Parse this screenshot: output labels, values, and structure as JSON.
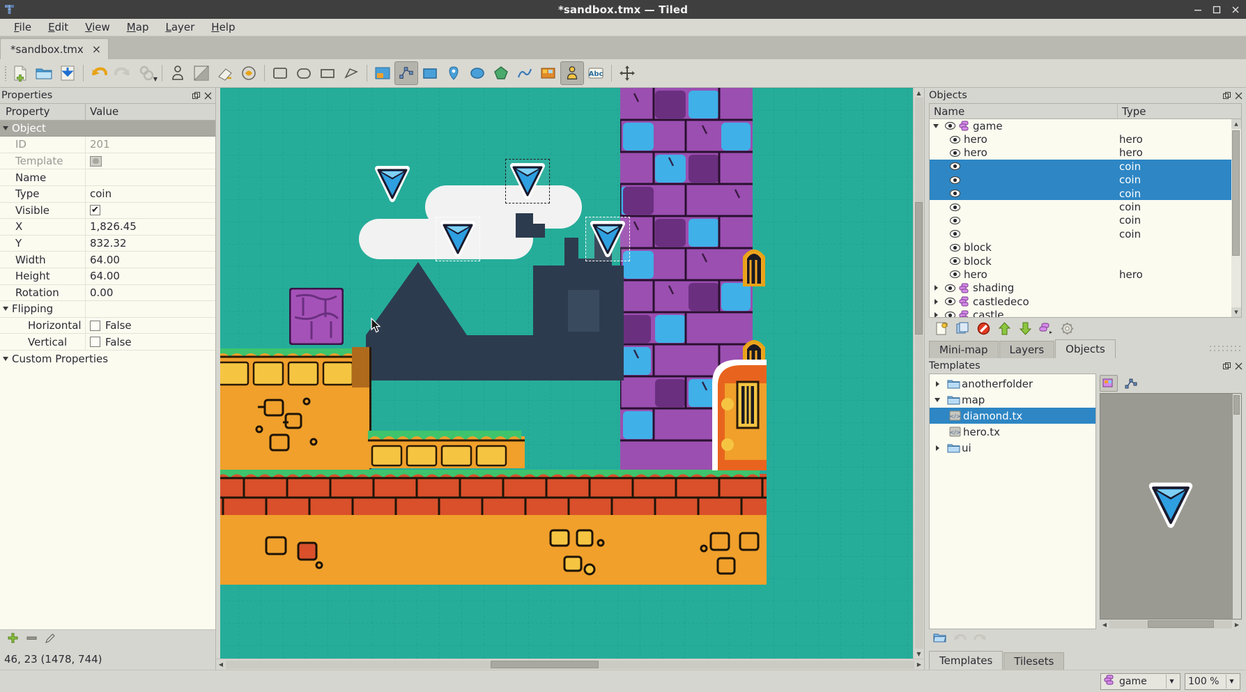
{
  "window": {
    "title": "*sandbox.tmx — Tiled",
    "icon": "tiled-logo-icon",
    "minimize": "minimize-icon",
    "maximize": "maximize-icon",
    "close": "close-icon"
  },
  "menubar": {
    "items": [
      {
        "label": "File",
        "accel": "F"
      },
      {
        "label": "Edit",
        "accel": "E"
      },
      {
        "label": "View",
        "accel": "V"
      },
      {
        "label": "Map",
        "accel": "M"
      },
      {
        "label": "Layer",
        "accel": "L"
      },
      {
        "label": "Help",
        "accel": "H"
      }
    ]
  },
  "document_tabs": [
    {
      "label": "*sandbox.tmx",
      "close": "×",
      "active": true
    }
  ],
  "toolbar": {
    "buttons": [
      {
        "name": "new-map-button",
        "icon": "new-document-icon"
      },
      {
        "name": "open-file-button",
        "icon": "open-folder-icon"
      },
      {
        "name": "save-file-button",
        "icon": "save-download-icon"
      },
      {
        "name": "undo-button",
        "icon": "undo-arrow-icon"
      },
      {
        "name": "redo-button",
        "icon": "redo-arrow-icon"
      },
      {
        "name": "map-properties-button",
        "icon": "gears-icon"
      },
      {
        "name": "stamp-brush-button",
        "icon": "stamp-icon"
      },
      {
        "name": "terrain-brush-button",
        "icon": "terrain-icon"
      },
      {
        "name": "eraser-button",
        "icon": "eraser-icon"
      },
      {
        "name": "bucket-fill-button",
        "icon": "bucket-fill-icon"
      },
      {
        "name": "rectangle-select-button",
        "icon": "rectangle-select-icon"
      },
      {
        "name": "magic-wand-button",
        "icon": "wand-select-icon"
      },
      {
        "name": "ellipse-select-button",
        "icon": "ellipse-select-icon"
      },
      {
        "name": "polygon-select-button",
        "icon": "polygon-select-icon"
      },
      {
        "name": "edit-polygons-button",
        "icon": "edit-polygon-icon"
      },
      {
        "name": "select-objects-button",
        "icon": "object-select-icon"
      },
      {
        "name": "insert-rectangle-button",
        "icon": "insert-rect-icon"
      },
      {
        "name": "insert-point-button",
        "icon": "insert-point-icon"
      },
      {
        "name": "insert-ellipse-button",
        "icon": "insert-ellipse-icon"
      },
      {
        "name": "insert-polygon-button",
        "icon": "insert-polygon-icon"
      },
      {
        "name": "insert-polyline-button",
        "icon": "insert-polyline-icon"
      },
      {
        "name": "insert-tile-button",
        "icon": "insert-tile-icon"
      },
      {
        "name": "insert-template-button",
        "icon": "insert-template-icon"
      },
      {
        "name": "insert-text-button",
        "icon": "insert-text-icon"
      },
      {
        "name": "pan-tool-button",
        "icon": "pan-move-icon"
      }
    ]
  },
  "properties_panel": {
    "title": "Properties",
    "float_icon": "float-panel-icon",
    "close_icon": "close-panel-icon",
    "columns": {
      "property": "Property",
      "value": "Value"
    },
    "groups": [
      {
        "label": "Object",
        "expanded": true,
        "rows": [
          {
            "name": "ID",
            "value": "201",
            "disabled": true,
            "kind": "text"
          },
          {
            "name": "Template",
            "value": "",
            "disabled": true,
            "kind": "template-button"
          },
          {
            "name": "Name",
            "value": "",
            "kind": "text"
          },
          {
            "name": "Type",
            "value": "coin",
            "kind": "text"
          },
          {
            "name": "Visible",
            "value": "",
            "kind": "checkbox",
            "checked": true
          },
          {
            "name": "X",
            "value": "1,826.45",
            "kind": "text"
          },
          {
            "name": "Y",
            "value": "832.32",
            "kind": "text"
          },
          {
            "name": "Width",
            "value": "64.00",
            "kind": "text"
          },
          {
            "name": "Height",
            "value": "64.00",
            "kind": "text"
          },
          {
            "name": "Rotation",
            "value": "0.00",
            "kind": "text"
          }
        ]
      },
      {
        "label": "Flipping",
        "expanded": true,
        "rows": [
          {
            "name": "Horizontal",
            "value": "False",
            "kind": "checkbox-label",
            "checked": false,
            "indent": 2
          },
          {
            "name": "Vertical",
            "value": "False",
            "kind": "checkbox-label",
            "checked": false,
            "indent": 2
          }
        ]
      },
      {
        "label": "Custom Properties",
        "expanded": true,
        "rows": []
      }
    ],
    "footer_buttons": [
      {
        "name": "add-property-button",
        "icon": "plus-icon"
      },
      {
        "name": "remove-property-button",
        "icon": "minus-icon"
      },
      {
        "name": "rename-property-button",
        "icon": "pencil-icon"
      }
    ]
  },
  "objects_panel": {
    "title": "Objects",
    "float_icon": "float-panel-icon",
    "close_icon": "close-panel-icon",
    "columns": {
      "name": "Name",
      "type": "Type"
    },
    "rows": [
      {
        "level": 1,
        "expander": "open",
        "icon": "layer-group-icon",
        "name": "game",
        "type": "",
        "selected": false
      },
      {
        "level": 2,
        "expander": "none",
        "icon": "eye-icon",
        "name": "hero",
        "type": "hero",
        "selected": false
      },
      {
        "level": 2,
        "expander": "none",
        "icon": "eye-icon",
        "name": "hero",
        "type": "hero",
        "selected": false
      },
      {
        "level": 2,
        "expander": "none",
        "icon": "eye-icon",
        "name": "",
        "type": "coin",
        "selected": true
      },
      {
        "level": 2,
        "expander": "none",
        "icon": "eye-icon",
        "name": "",
        "type": "coin",
        "selected": true
      },
      {
        "level": 2,
        "expander": "none",
        "icon": "eye-icon",
        "name": "",
        "type": "coin",
        "selected": true
      },
      {
        "level": 2,
        "expander": "none",
        "icon": "eye-icon",
        "name": "",
        "type": "coin",
        "selected": false
      },
      {
        "level": 2,
        "expander": "none",
        "icon": "eye-icon",
        "name": "",
        "type": "coin",
        "selected": false
      },
      {
        "level": 2,
        "expander": "none",
        "icon": "eye-icon",
        "name": "",
        "type": "coin",
        "selected": false
      },
      {
        "level": 2,
        "expander": "none",
        "icon": "eye-icon",
        "name": "block",
        "type": "",
        "selected": false
      },
      {
        "level": 2,
        "expander": "none",
        "icon": "eye-icon",
        "name": "block",
        "type": "",
        "selected": false
      },
      {
        "level": 2,
        "expander": "none",
        "icon": "eye-icon",
        "name": "hero",
        "type": "hero",
        "selected": false
      },
      {
        "level": 1,
        "expander": "closed",
        "icon": "layer-group-icon",
        "name": "shading",
        "type": "",
        "selected": false
      },
      {
        "level": 1,
        "expander": "closed",
        "icon": "layer-group-icon",
        "name": "castledeco",
        "type": "",
        "selected": false
      },
      {
        "level": 1,
        "expander": "closed",
        "icon": "layer-group-icon",
        "name": "castle",
        "type": "",
        "selected": false
      }
    ],
    "toolbar_buttons": [
      {
        "name": "new-object-button",
        "icon": "new-object-icon"
      },
      {
        "name": "duplicate-object-button",
        "icon": "duplicate-icon"
      },
      {
        "name": "remove-object-button",
        "icon": "forbidden-icon"
      },
      {
        "name": "move-up-button",
        "icon": "up-arrow-icon"
      },
      {
        "name": "move-down-button",
        "icon": "down-arrow-icon"
      },
      {
        "name": "object-layer-button",
        "icon": "object-layer-icon"
      },
      {
        "name": "object-settings-button",
        "icon": "gear-icon"
      }
    ],
    "tabs": [
      {
        "label": "Mini-map",
        "active": false
      },
      {
        "label": "Layers",
        "active": false
      },
      {
        "label": "Objects",
        "active": true
      }
    ]
  },
  "templates_panel": {
    "title": "Templates",
    "float_icon": "float-panel-icon",
    "close_icon": "close-panel-icon",
    "tree": [
      {
        "level": 1,
        "expander": "closed",
        "icon": "folder-icon",
        "label": "anotherfolder",
        "selected": false
      },
      {
        "level": 1,
        "expander": "open",
        "icon": "folder-icon",
        "label": "map",
        "selected": false
      },
      {
        "level": 2,
        "expander": "none",
        "icon": "code-file-icon",
        "label": "diamond.tx",
        "selected": true
      },
      {
        "level": 2,
        "expander": "none",
        "icon": "code-file-icon",
        "label": "hero.tx",
        "selected": false
      },
      {
        "level": 1,
        "expander": "closed",
        "icon": "folder-icon",
        "label": "ui",
        "selected": false
      }
    ],
    "side_buttons": [
      {
        "name": "template-tileset-button",
        "icon": "tileset-icon"
      },
      {
        "name": "template-edit-button",
        "icon": "edit-template-icon"
      }
    ],
    "footer_buttons": [
      {
        "name": "open-template-folder-button",
        "icon": "folder-open-icon"
      },
      {
        "name": "template-undo-button",
        "icon": "undo-arrow-icon"
      },
      {
        "name": "template-redo-button",
        "icon": "redo-arrow-icon"
      }
    ],
    "preview_object": "diamond-gem-preview",
    "tabs": [
      {
        "label": "Templates",
        "active": true
      },
      {
        "label": "Tilesets",
        "active": false
      }
    ]
  },
  "statusbar": {
    "coordinates": "46, 23 (1478, 744)",
    "layer_selector": {
      "value": "game",
      "icon": "layer-group-icon",
      "caret": "▼"
    },
    "zoom": {
      "value": "100 %",
      "caret": "▼"
    }
  },
  "map_view": {
    "background_color": "#25ad9a",
    "selected_objects": 4,
    "scroll_h_position": 0.45,
    "scroll_v_position": 0.35,
    "cursor": "arrow-cursor"
  },
  "colors": {
    "selection_blue": "#2e86c4",
    "panel_bg": "#d6d6d0",
    "tree_bg": "#fbfbf0",
    "titlebar_bg": "#3f3f3f",
    "map_sky": "#25ad9a",
    "gem_blue": "#2e9fe0",
    "brick_orange": "#ef8b28",
    "brick_red": "#d9502b",
    "castle_purple": "#a44fb0",
    "dark_navy": "#2d3b4e"
  }
}
